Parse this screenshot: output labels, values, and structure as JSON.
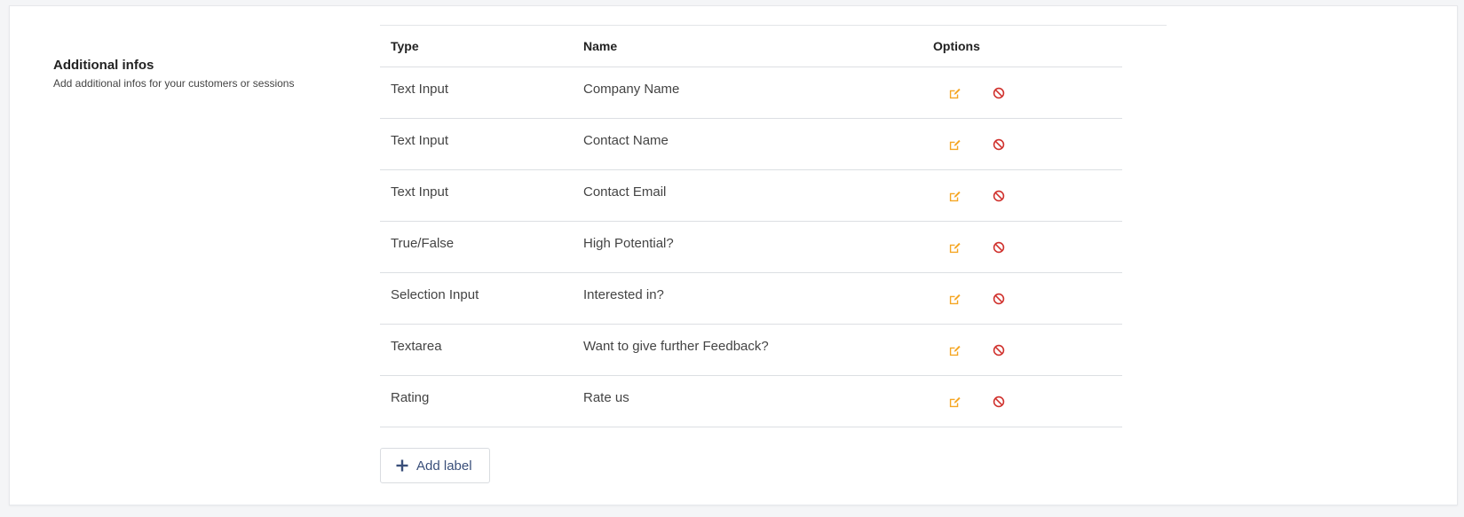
{
  "section": {
    "title": "Additional infos",
    "subtitle": "Add additional infos for your customers or sessions"
  },
  "table": {
    "headers": {
      "type": "Type",
      "name": "Name",
      "options": "Options"
    },
    "rows": [
      {
        "type": "Text Input",
        "name": "Company Name"
      },
      {
        "type": "Text Input",
        "name": "Contact Name"
      },
      {
        "type": "Text Input",
        "name": "Contact Email"
      },
      {
        "type": "True/False",
        "name": "High Potential?"
      },
      {
        "type": "Selection Input",
        "name": "Interested in?"
      },
      {
        "type": "Textarea",
        "name": "Want to give further Feedback?"
      },
      {
        "type": "Rating",
        "name": "Rate us"
      }
    ]
  },
  "actions": {
    "add_label": "Add label"
  },
  "icons": {
    "edit": "edit-icon",
    "delete": "ban-icon",
    "add": "plus-icon"
  },
  "colors": {
    "edit": "#f5a623",
    "delete": "#d0312d",
    "button_text": "#3a4f7a"
  }
}
